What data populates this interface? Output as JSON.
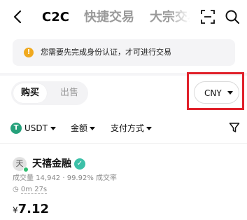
{
  "nav": {
    "tabs": [
      {
        "label": "C2C"
      },
      {
        "label": "快捷交易"
      },
      {
        "label": "大宗交易"
      }
    ]
  },
  "notice": {
    "icon": "warning-icon",
    "text": "您需要先完成身份认证，才可进行交易"
  },
  "trade_side": {
    "buy_label": "购买",
    "sell_label": "出售"
  },
  "currency": {
    "selected": "CNY"
  },
  "filters": {
    "asset": "USDT",
    "amount": "金额",
    "payment": "支付方式"
  },
  "merchant": {
    "avatar_char": "天",
    "name": "天禧金融",
    "stats": "成交量 14,942 · 99.92% 成交率",
    "time": "0m 27s",
    "currency_symbol": "¥",
    "price": "7.12"
  },
  "colors": {
    "accent_green": "#26a17b",
    "warning": "#f0a91e",
    "highlight_box": "#e0202a"
  }
}
